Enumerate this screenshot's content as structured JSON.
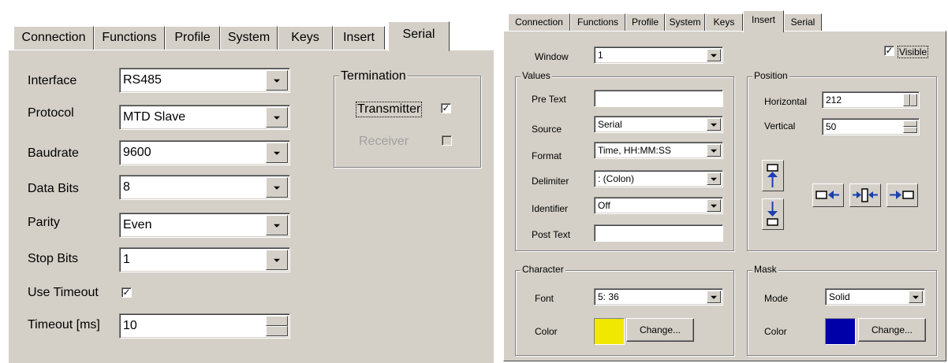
{
  "left": {
    "tabs": [
      "Connection",
      "Functions",
      "Profile",
      "System",
      "Keys",
      "Insert",
      "Serial"
    ],
    "active_tab": "Serial",
    "fields": {
      "interface": {
        "label": "Interface",
        "value": "RS485"
      },
      "protocol": {
        "label": "Protocol",
        "value": "MTD Slave"
      },
      "baudrate": {
        "label": "Baudrate",
        "value": "9600"
      },
      "data_bits": {
        "label": "Data Bits",
        "value": "8"
      },
      "parity": {
        "label": "Parity",
        "value": "Even"
      },
      "stop_bits": {
        "label": "Stop Bits",
        "value": "1"
      },
      "use_timeout": {
        "label": "Use Timeout",
        "checked": true
      },
      "timeout": {
        "label": "Timeout [ms]",
        "value": "10"
      }
    },
    "termination": {
      "title": "Termination",
      "transmitter": {
        "label": "Transmitter",
        "checked": true
      },
      "receiver": {
        "label": "Receiver",
        "checked": false,
        "disabled": true
      }
    }
  },
  "right": {
    "tabs": [
      "Connection",
      "Functions",
      "Profile",
      "System",
      "Keys",
      "Insert",
      "Serial"
    ],
    "active_tab": "Insert",
    "window": {
      "label": "Window",
      "value": "1"
    },
    "visible": {
      "label": "Visible",
      "checked": true
    },
    "values_group": {
      "title": "Values",
      "pre_text": {
        "label": "Pre Text",
        "value": ""
      },
      "source": {
        "label": "Source",
        "value": "Serial"
      },
      "format": {
        "label": "Format",
        "value": "Time, HH:MM:SS"
      },
      "delimiter": {
        "label": "Delimiter",
        "value": ":  (Colon)"
      },
      "identifier": {
        "label": "Identifier",
        "value": "Off"
      },
      "post_text": {
        "label": "Post Text",
        "value": ""
      }
    },
    "position_group": {
      "title": "Position",
      "horizontal": {
        "label": "Horizontal",
        "value": "212"
      },
      "vertical": {
        "label": "Vertical",
        "value": "50"
      }
    },
    "character_group": {
      "title": "Character",
      "font": {
        "label": "Font",
        "value": "5: 36"
      },
      "color": {
        "label": "Color",
        "swatch": "#f0e800"
      },
      "change_label": "Change..."
    },
    "mask_group": {
      "title": "Mask",
      "mode": {
        "label": "Mode",
        "value": "Solid"
      },
      "color": {
        "label": "Color",
        "swatch": "#0000a8"
      },
      "change_label": "Change..."
    }
  },
  "colors": {
    "face": "#d4d0c8",
    "arrow_blue": "#1a3fb0"
  }
}
